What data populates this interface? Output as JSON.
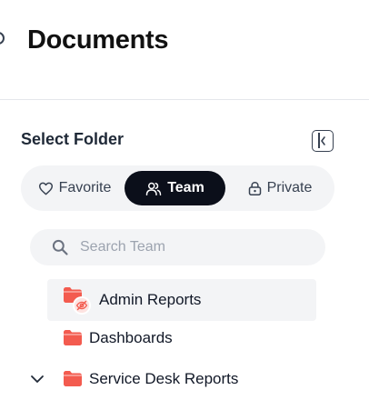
{
  "header": {
    "title": "Documents"
  },
  "folder_panel": {
    "title": "Select Folder",
    "tabs": [
      {
        "label": "Favorite",
        "icon": "heart-icon"
      },
      {
        "label": "Team",
        "icon": "users-icon",
        "active": true
      },
      {
        "label": "Private",
        "icon": "lock-icon"
      }
    ],
    "search": {
      "placeholder": "Search Team",
      "value": ""
    },
    "folders": [
      {
        "label": "Admin Reports",
        "icon": "folder-icon",
        "badge": "hidden-eye-icon",
        "selected": true
      },
      {
        "label": "Dashboards",
        "icon": "folder-icon"
      },
      {
        "label": "Service Desk Reports",
        "icon": "folder-icon",
        "expanded": true
      }
    ]
  },
  "colors": {
    "folder": "#f35b4f",
    "active_tab_bg": "#0b0f1a",
    "panel_bg": "#f3f4f6"
  }
}
